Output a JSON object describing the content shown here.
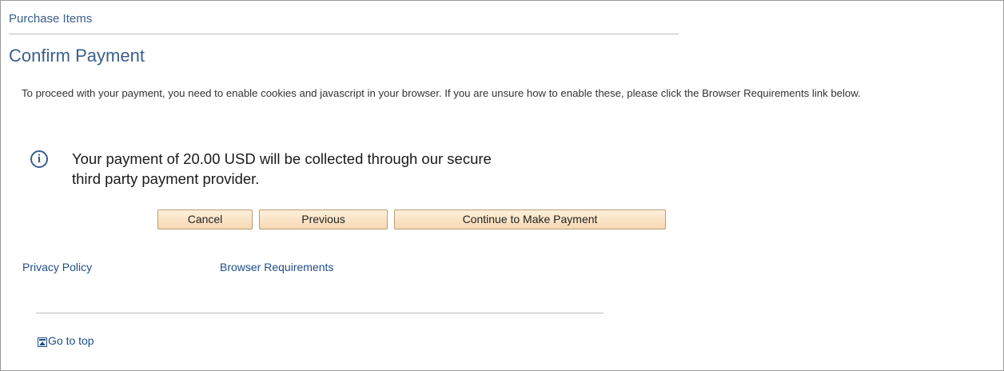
{
  "breadcrumb": {
    "label": "Purchase Items"
  },
  "page": {
    "title": "Confirm Payment"
  },
  "instructions": {
    "text": "To proceed with your payment, you need to enable cookies and javascript in your browser. If you are unsure how to enable these, please click the Browser Requirements link below."
  },
  "info": {
    "icon": "info-circle",
    "message_line1": "Your payment of 20.00 USD will be collected through our secure",
    "message_line2": "third party payment provider."
  },
  "buttons": {
    "cancel": "Cancel",
    "previous": "Previous",
    "continue": "Continue to Make Payment"
  },
  "links": {
    "privacy": "Privacy Policy",
    "browser_requirements": "Browser Requirements"
  },
  "footer": {
    "go_to_top": "Go to top",
    "icon": "go-to-top"
  },
  "colors": {
    "heading": "#3a5f8a",
    "link": "#1f4e8a",
    "button_bg": "#f6d9b4",
    "button_border": "#b89c78"
  }
}
